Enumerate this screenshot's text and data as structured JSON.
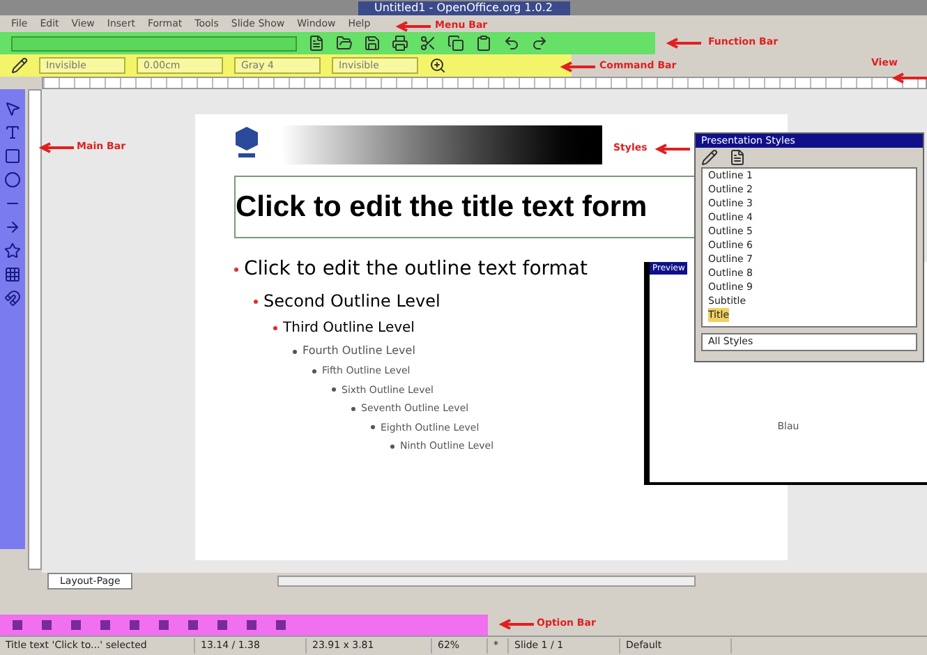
{
  "window": {
    "title": "Untitled1 - OpenOffice.org 1.0.2"
  },
  "menu": [
    "File",
    "Edit",
    "View",
    "Insert",
    "Format",
    "Tools",
    "Slide Show",
    "Window",
    "Help"
  ],
  "command_bar": {
    "fields": [
      "Invisible",
      "0.00cm",
      "Gray 4",
      "Invisible"
    ]
  },
  "slide": {
    "title": "Click to edit the title text form",
    "outline": [
      "Click to edit the outline text format",
      "Second Outline Level",
      "Third Outline Level",
      "Fourth Outline Level",
      "Fifth Outline Level",
      "Sixth Outline Level",
      "Seventh Outline Level",
      "Eighth Outline Level",
      "Ninth Outline Level"
    ]
  },
  "styles_panel": {
    "title": "Presentation Styles",
    "items": [
      {
        "label": "Outline 1",
        "selected": false
      },
      {
        "label": "Outline 2",
        "selected": false
      },
      {
        "label": "Outline 3",
        "selected": false
      },
      {
        "label": "Outline 4",
        "selected": false
      },
      {
        "label": "Outline 5",
        "selected": false
      },
      {
        "label": "Outline 6",
        "selected": false
      },
      {
        "label": "Outline 7",
        "selected": false
      },
      {
        "label": "Outline 8",
        "selected": false
      },
      {
        "label": "Outline 9",
        "selected": false
      },
      {
        "label": "Subtitle",
        "selected": false
      },
      {
        "label": "Title",
        "selected": true
      }
    ],
    "filter": "All Styles"
  },
  "preview_panel": {
    "title": "Preview",
    "text": "Blau"
  },
  "page_tabs": [
    {
      "label": "Layout-Page",
      "selected": true
    }
  ],
  "annotations": [
    {
      "label": "Menu Bar"
    },
    {
      "label": "Function Bar"
    },
    {
      "label": "Command Bar"
    },
    {
      "label": "View"
    },
    {
      "label": "Main Bar"
    },
    {
      "label": "Styles"
    },
    {
      "label": "Option Bar"
    }
  ],
  "status_bar": [
    "Title text 'Click to...' selected",
    "13.14 / 1.38",
    "23.91 x 3.81",
    "62%",
    "*",
    "Slide 1 / 1",
    "Default"
  ]
}
